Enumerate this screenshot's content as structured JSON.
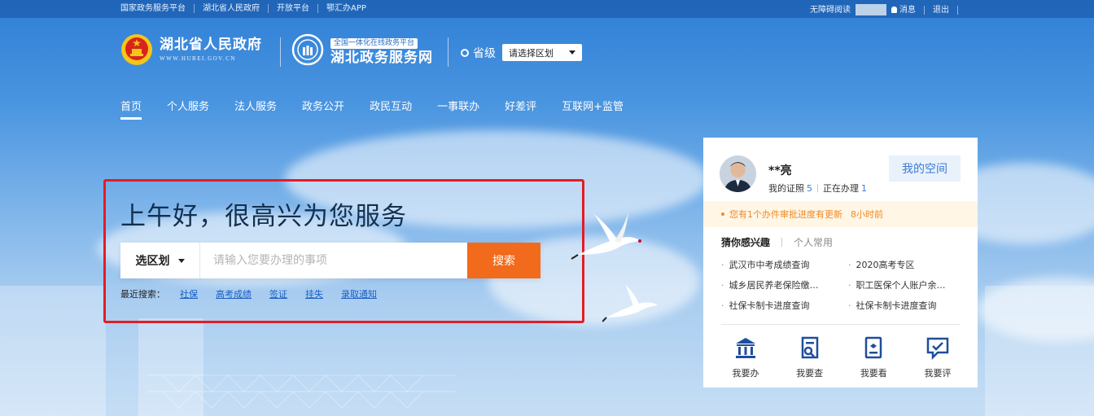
{
  "topbar": {
    "links": [
      "国家政务服务平台",
      "湖北省人民政府",
      "开放平台",
      "鄂汇办APP"
    ],
    "accessible": "无障碍阅读",
    "messages": "消息",
    "logout": "退出"
  },
  "header": {
    "gov_name": "湖北省人民政府",
    "gov_url": "WWW.HUBEI.GOV.CN",
    "platform_badge": "全国一体化在线政务平台",
    "platform_name": "湖北政务服务网",
    "level": "省级",
    "region_select": "请选择区划"
  },
  "nav": {
    "items": [
      "首页",
      "个人服务",
      "法人服务",
      "政务公开",
      "政民互动",
      "一事联办",
      "好差评",
      "互联网+监管"
    ],
    "active": "首页"
  },
  "search": {
    "greeting": "上午好，很高兴为您服务",
    "region_label": "选区划",
    "placeholder": "请输入您要办理的事项",
    "button": "搜索",
    "recent_label": "最近搜索：",
    "recent": [
      "社保",
      "高考成绩",
      "签证",
      "挂失",
      "录取通知"
    ]
  },
  "user": {
    "name": "**亮",
    "certs_label": "我的证照",
    "certs_count": "5",
    "processing_label": "正在办理",
    "processing_count": "1",
    "my_space": "我的空间",
    "notice": "您有1个办件审批进度有更新",
    "notice_time": "8小时前",
    "tab_interest": "猜你感兴趣",
    "tab_common": "个人常用",
    "items": [
      "武汉市中考成绩查询",
      "2020高考专区",
      "城乡居民养老保险缴…",
      "职工医保个人账户余…",
      "社保卡制卡进度查询",
      "社保卡制卡进度查询"
    ],
    "actions": [
      {
        "label": "我要办",
        "icon": "bank-icon"
      },
      {
        "label": "我要查",
        "icon": "document-search-icon"
      },
      {
        "label": "我要看",
        "icon": "tablet-icon"
      },
      {
        "label": "我要评",
        "icon": "comment-icon"
      }
    ]
  },
  "colors": {
    "accent": "#f26a1b",
    "link": "#1b5fc2",
    "highlight_frame": "#e51c23",
    "notice": "#f08a24"
  }
}
